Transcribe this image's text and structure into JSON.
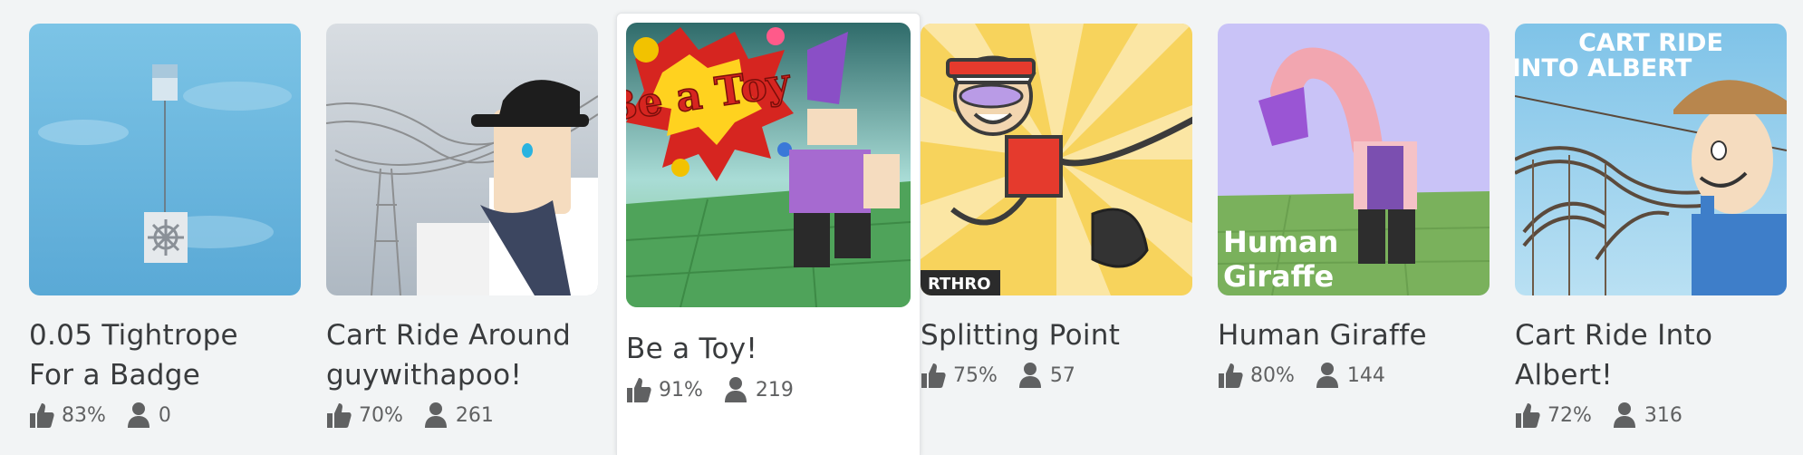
{
  "games": [
    {
      "title_line1": "0.05 Tightrope",
      "title_line2": "For a Badge",
      "rating": "83%",
      "players": "0"
    },
    {
      "title_line1": "Cart Ride Around",
      "title_line2": "guywithapoo!",
      "rating": "70%",
      "players": "261"
    },
    {
      "title_line1": "Be a Toy!",
      "title_line2": "",
      "rating": "91%",
      "players": "219",
      "thumb_text": "Be a Toy"
    },
    {
      "title_line1": "Splitting Point",
      "title_line2": "",
      "rating": "75%",
      "players": "57",
      "thumb_badge": "RTHRO"
    },
    {
      "title_line1": "Human Giraffe",
      "title_line2": "",
      "rating": "80%",
      "players": "144",
      "thumb_line1": "Human",
      "thumb_line2": "Giraffe"
    },
    {
      "title_line1": "Cart Ride Into",
      "title_line2": "Albert!",
      "rating": "72%",
      "players": "316",
      "thumb_line1": "CART RIDE",
      "thumb_line2": "INTO ALBERT"
    }
  ],
  "icons": {
    "rating": "thumbs-up-icon",
    "players": "player-icon"
  },
  "colors": {
    "background": "#f2f4f5",
    "text": "#393b3d",
    "stat_text": "#606162",
    "hover_card": "#ffffff"
  }
}
